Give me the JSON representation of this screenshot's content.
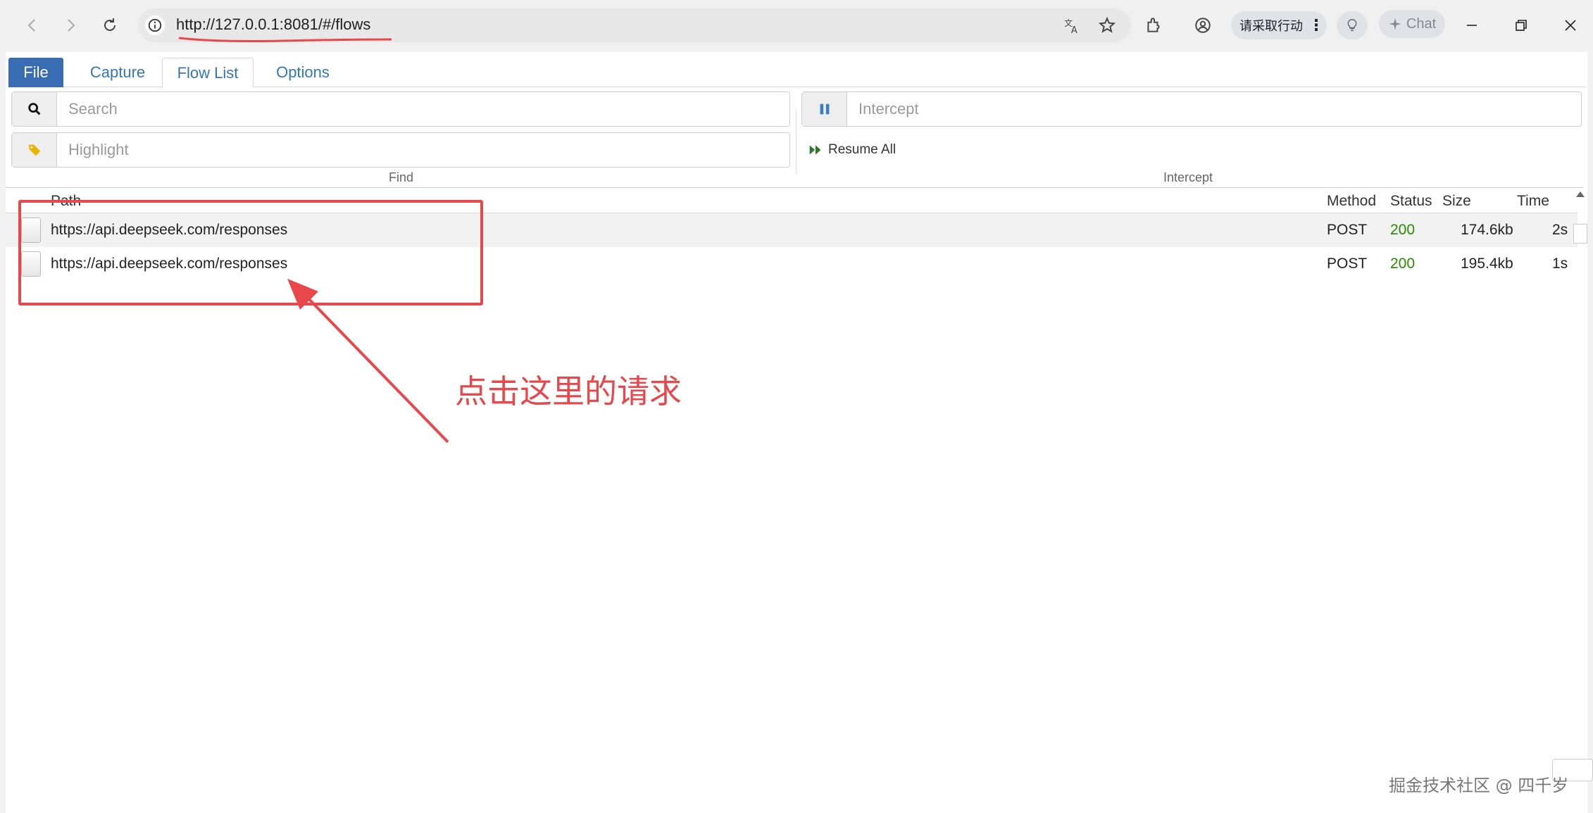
{
  "browser": {
    "url": "http://127.0.0.1:8081/#/flows",
    "action_pill_label": "请采取行动",
    "chat_label": "Chat"
  },
  "tabs": [
    {
      "label": "File"
    },
    {
      "label": "Capture"
    },
    {
      "label": "Flow List"
    },
    {
      "label": "Options"
    }
  ],
  "find": {
    "search_placeholder": "Search",
    "highlight_placeholder": "Highlight",
    "section_label": "Find"
  },
  "intercept": {
    "intercept_placeholder": "Intercept",
    "resume_all_label": "Resume All",
    "section_label": "Intercept"
  },
  "flow_table": {
    "columns": {
      "path": "Path",
      "method": "Method",
      "status": "Status",
      "size": "Size",
      "time": "Time"
    },
    "rows": [
      {
        "path": "https://api.deepseek.com/responses",
        "method": "POST",
        "status": "200",
        "size": "174.6kb",
        "time": "2s"
      },
      {
        "path": "https://api.deepseek.com/responses",
        "method": "POST",
        "status": "200",
        "size": "195.4kb",
        "time": "1s"
      }
    ]
  },
  "annotation": {
    "text": "点击这里的请求",
    "color": "#e8484c"
  },
  "watermark": "掘金技术社区 @ 四千岁",
  "colors": {
    "file_tab_bg": "#396cb2",
    "link_blue": "#3377b7",
    "status_ok": "#2a8a00"
  }
}
